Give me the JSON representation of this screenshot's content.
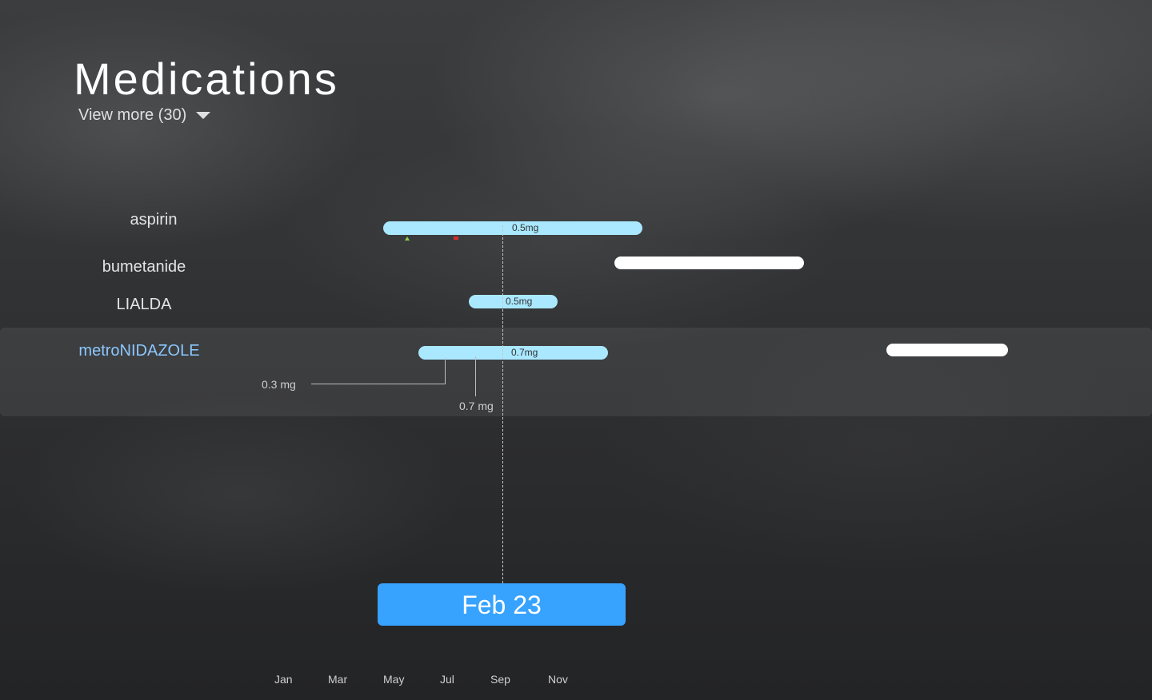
{
  "header": {
    "title": "Medications",
    "view_more": "View more (30)"
  },
  "medications": [
    {
      "name": "aspirin",
      "dose_label": "0.5mg"
    },
    {
      "name": "bumetanide"
    },
    {
      "name": "LIALDA",
      "dose_label": "0.5mg"
    },
    {
      "name": "metroNIDAZOLE",
      "dose_label": "0.7mg",
      "active": true,
      "dose_changes": [
        "0.3 mg",
        "0.7 mg"
      ]
    }
  ],
  "current_date": "Feb 23",
  "timeline": {
    "ticks": [
      "Jan",
      "Mar",
      "May",
      "Jul",
      "Sep",
      "Nov"
    ]
  },
  "colors": {
    "bar_active": "#a9e8ff",
    "bar_other": "#ffffff",
    "accent": "#37a3ff",
    "selected_label": "#8cc8ff",
    "start_marker": "#8fd14f",
    "stop_marker": "#d0312d"
  }
}
